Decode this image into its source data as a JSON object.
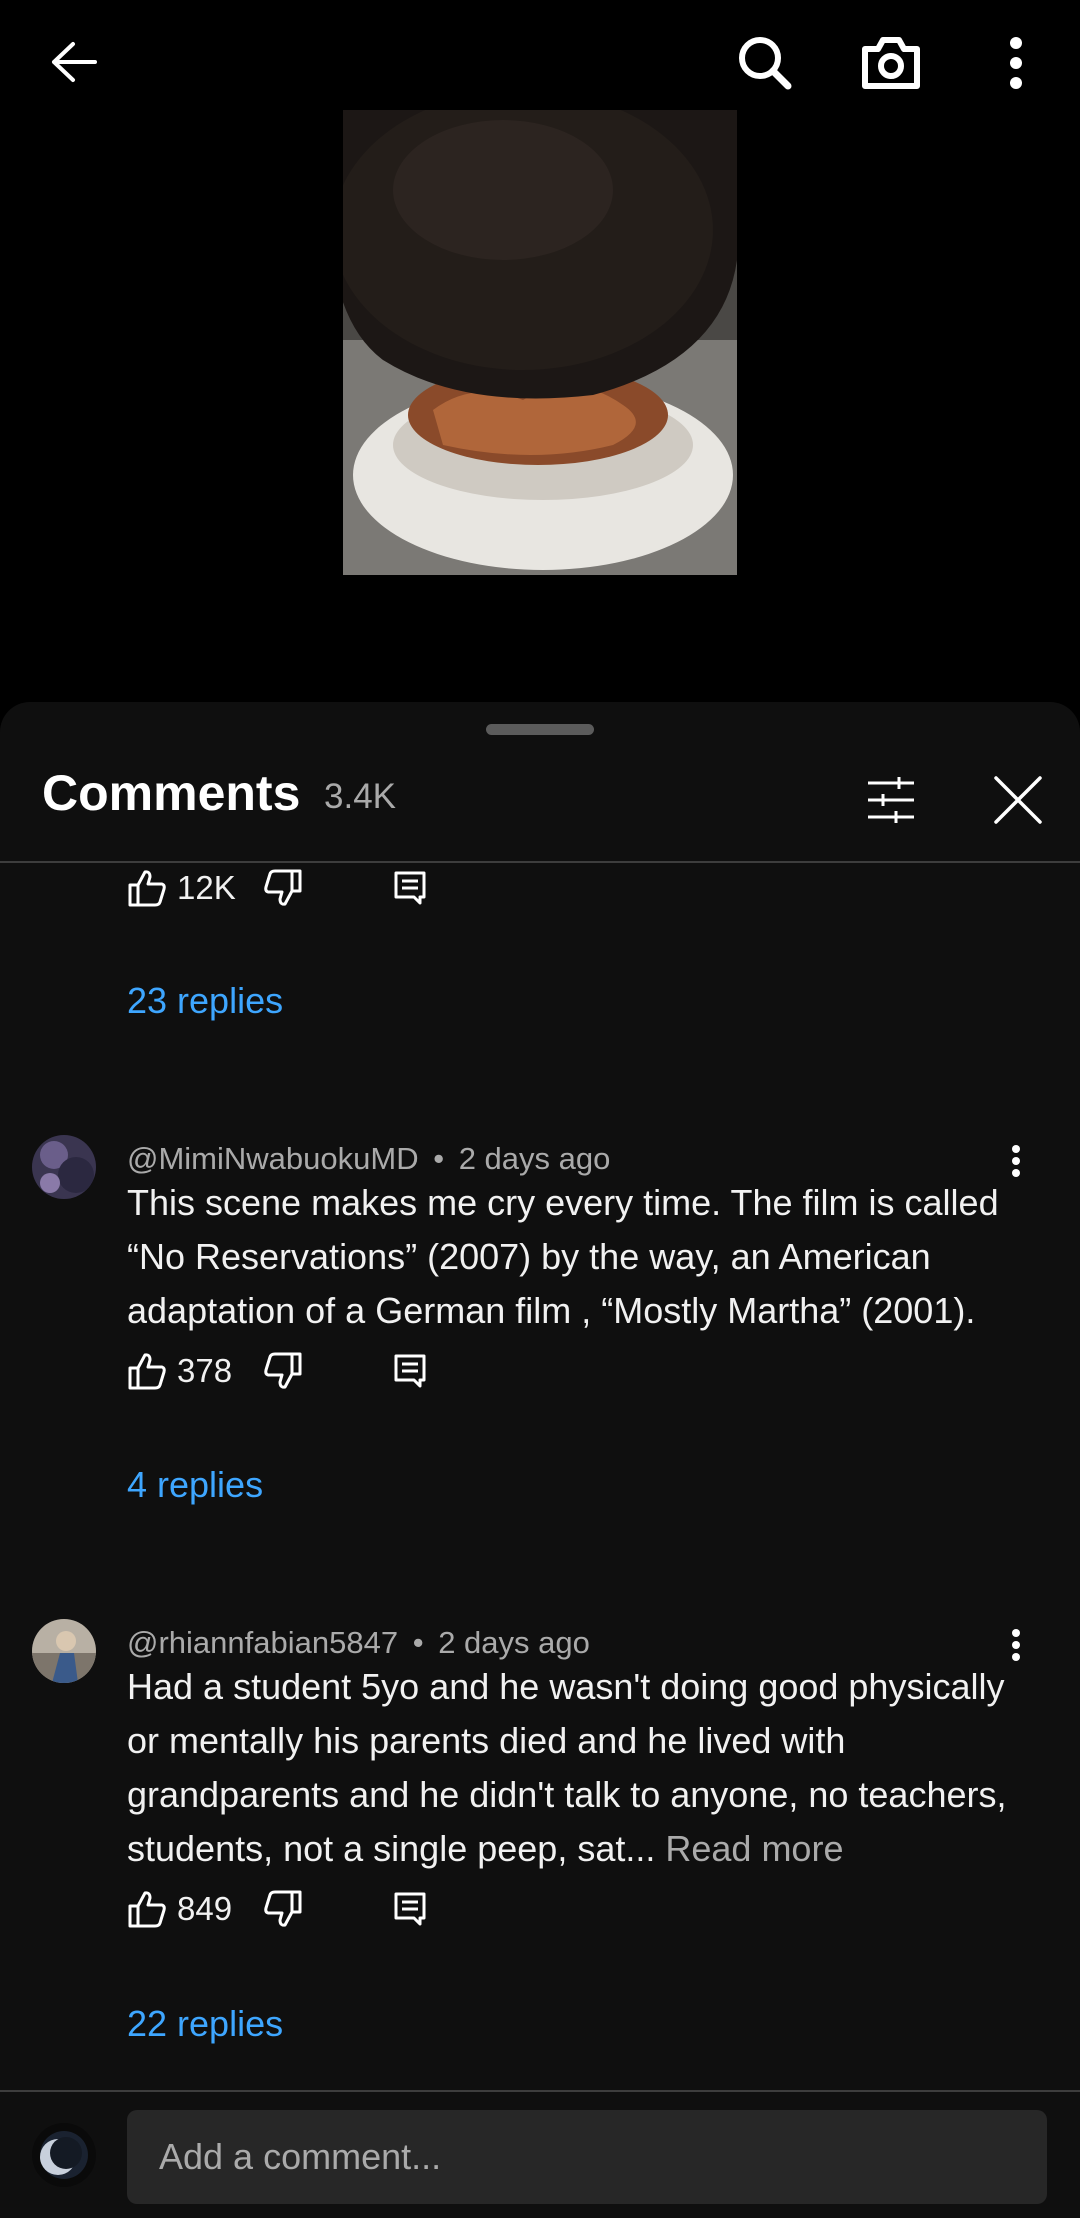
{
  "header": {
    "back_icon": "arrow-left-icon",
    "search_icon": "search-icon",
    "camera_icon": "camera-icon",
    "more_icon": "more-vertical-icon"
  },
  "sheet": {
    "title": "Comments",
    "count": "3.4K",
    "filter_icon": "sliders-icon",
    "close_icon": "close-icon"
  },
  "partial_comment": {
    "likes": "12K",
    "replies": "23 replies"
  },
  "comments": [
    {
      "author": "@MimiNwabuokuMD",
      "time": "2 days ago",
      "text": "This scene makes me cry every time. The film is called “No Reservations” (2007) by the way, an American adaptation of a German film , “Mostly Martha” (2001).",
      "likes": "378",
      "replies": "4 replies"
    },
    {
      "author": "@rhiannfabian5847",
      "time": "2 days ago",
      "text": "Had a student 5yo and he wasn't doing good physically or mentally his parents died and he lived with grandparents and he didn't talk to anyone, no teachers, students, not a single peep, sat...",
      "read_more": "Read more",
      "likes": "849",
      "replies": "22 replies"
    }
  ],
  "footer": {
    "placeholder": "Add a comment..."
  },
  "colors": {
    "background": "#0f0f0f",
    "link": "#3ea6ff",
    "secondary_text": "#aaaaaa",
    "input_bg": "#272727"
  }
}
